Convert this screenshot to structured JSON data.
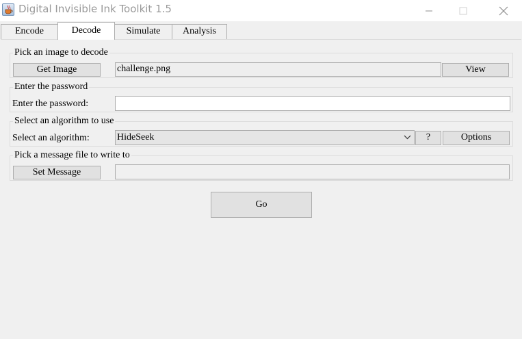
{
  "window": {
    "title": "Digital Invisible Ink Toolkit 1.5",
    "icon": "java-cup-icon",
    "controls": [
      "minimize-icon",
      "maximize-icon",
      "close-icon"
    ]
  },
  "tabs": [
    {
      "label": "Encode",
      "active": false
    },
    {
      "label": "Decode",
      "active": true
    },
    {
      "label": "Simulate",
      "active": false
    },
    {
      "label": "Analysis",
      "active": false
    }
  ],
  "image_group": {
    "title": "Pick an image to decode",
    "get_image_label": "Get Image",
    "image_path": "challenge.png",
    "view_label": "View"
  },
  "password_group": {
    "title": "Enter the password",
    "label": "Enter the password:",
    "value": ""
  },
  "algorithm_group": {
    "title": "Select an algorithm to use",
    "label": "Select an algorithm:",
    "selected": "HideSeek",
    "help_label": "?",
    "options_label": "Options"
  },
  "message_group": {
    "title": "Pick a message file to write to",
    "set_message_label": "Set Message",
    "message_path": ""
  },
  "go_label": "Go",
  "colors": {
    "background": "#f0f0f0",
    "button_face": "#e1e1e1",
    "border": "#adadad",
    "title_text": "#999999"
  }
}
